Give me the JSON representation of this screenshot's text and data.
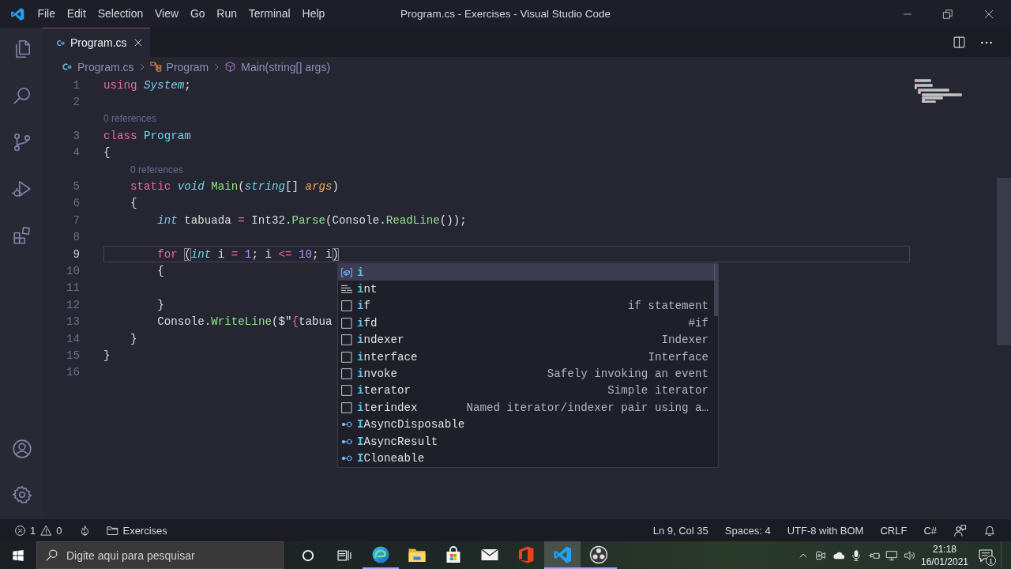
{
  "window": {
    "title": "Program.cs - Exercises - Visual Studio Code"
  },
  "menu": [
    "File",
    "Edit",
    "Selection",
    "View",
    "Go",
    "Run",
    "Terminal",
    "Help"
  ],
  "tabs": [
    {
      "label": "Program.cs",
      "selected": true
    }
  ],
  "breadcrumbs": [
    "Program.cs",
    "Program",
    "Main(string[] args)"
  ],
  "editor": {
    "lines": [
      {
        "kind": "code",
        "number": "1",
        "current": false,
        "tokens": [
          {
            "kind": "keyword",
            "text": "using "
          },
          {
            "kind": "type",
            "text": "System"
          },
          {
            "kind": "plain",
            "text": ";"
          }
        ]
      },
      {
        "kind": "code",
        "number": "2",
        "current": false
      },
      {
        "kind": "codelens",
        "text": "0 references"
      },
      {
        "kind": "code",
        "number": "3",
        "current": false,
        "tokens": [
          {
            "kind": "keyword",
            "text": "class "
          },
          {
            "kind": "class",
            "text": "Program"
          }
        ]
      },
      {
        "kind": "code",
        "number": "4",
        "current": false,
        "tokens": [
          {
            "kind": "plain",
            "text": "{"
          }
        ]
      },
      {
        "kind": "codelens",
        "text": "    0 references"
      },
      {
        "kind": "code",
        "number": "5",
        "current": false,
        "tokens": [
          {
            "kind": "keyword",
            "text": "    static "
          },
          {
            "kind": "type",
            "text": "void "
          },
          {
            "kind": "method",
            "text": "Main"
          },
          {
            "kind": "plain",
            "text": "("
          },
          {
            "kind": "type",
            "text": "string"
          },
          {
            "kind": "plain",
            "text": "[] "
          },
          {
            "kind": "param",
            "text": "args"
          },
          {
            "kind": "plain",
            "text": ")"
          }
        ]
      },
      {
        "kind": "code",
        "number": "6",
        "current": false,
        "tokens": [
          {
            "kind": "plain",
            "text": "    {"
          }
        ]
      },
      {
        "kind": "code",
        "number": "7",
        "current": false,
        "tokens": [
          {
            "kind": "type",
            "text": "        int"
          },
          {
            "kind": "plain",
            "text": " tabuada "
          },
          {
            "kind": "operator",
            "text": "="
          },
          {
            "kind": "plain",
            "text": " Int32."
          },
          {
            "kind": "method",
            "text": "Parse"
          },
          {
            "kind": "plain",
            "text": "(Console."
          },
          {
            "kind": "method",
            "text": "ReadLine"
          },
          {
            "kind": "plain",
            "text": "());"
          }
        ]
      },
      {
        "kind": "code",
        "number": "8",
        "current": false
      },
      {
        "kind": "code",
        "number": "9",
        "current": true,
        "tokens": [
          {
            "kind": "keyword",
            "text": "        for "
          },
          {
            "kind": "bracket",
            "text": "("
          },
          {
            "kind": "type",
            "text": "int"
          },
          {
            "kind": "plain",
            "text": " i "
          },
          {
            "kind": "operator",
            "text": "= "
          },
          {
            "kind": "number",
            "text": "1"
          },
          {
            "kind": "plain",
            "text": "; i "
          },
          {
            "kind": "operator",
            "text": "<= "
          },
          {
            "kind": "number",
            "text": "10"
          },
          {
            "kind": "plain",
            "text": "; i"
          },
          {
            "kind": "bracket",
            "text": ")"
          }
        ]
      },
      {
        "kind": "code",
        "number": "10",
        "current": false,
        "tokens": [
          {
            "kind": "plain",
            "text": "        {"
          }
        ]
      },
      {
        "kind": "code",
        "number": "11",
        "current": false
      },
      {
        "kind": "code",
        "number": "12",
        "current": false,
        "tokens": [
          {
            "kind": "plain",
            "text": "        }"
          }
        ]
      },
      {
        "kind": "code",
        "number": "13",
        "current": false,
        "tokens": [
          {
            "kind": "plain",
            "text": "        Console."
          },
          {
            "kind": "method",
            "text": "WriteLine"
          },
          {
            "kind": "plain",
            "text": "($\""
          },
          {
            "kind": "operator",
            "text": "{"
          },
          {
            "kind": "plain",
            "text": "tabua"
          }
        ]
      },
      {
        "kind": "code",
        "number": "14",
        "current": false,
        "tokens": [
          {
            "kind": "plain",
            "text": "    }"
          }
        ]
      },
      {
        "kind": "code",
        "number": "15",
        "current": false,
        "tokens": [
          {
            "kind": "plain",
            "text": "}"
          }
        ]
      },
      {
        "kind": "code",
        "number": "16",
        "current": false
      }
    ]
  },
  "suggestions": [
    {
      "kind": "variable",
      "label": "i",
      "full_match": true,
      "selected": true
    },
    {
      "kind": "keyword",
      "label": "**i**nt",
      "full_match": false,
      "selected": false
    },
    {
      "kind": "snippet",
      "label": "**i**f",
      "detail": "if statement",
      "full_match": false,
      "selected": false
    },
    {
      "kind": "snippet",
      "label": "**i**fd",
      "detail": "#if",
      "full_match": false,
      "selected": false
    },
    {
      "kind": "snippet",
      "label": "**i**ndexer",
      "detail": "Indexer",
      "full_match": false,
      "selected": false
    },
    {
      "kind": "snippet",
      "label": "**i**nterface",
      "detail": "Interface",
      "full_match": false,
      "selected": false
    },
    {
      "kind": "snippet",
      "label": "**i**nvoke",
      "detail": "Safely invoking an event",
      "full_match": false,
      "selected": false
    },
    {
      "kind": "snippet",
      "label": "**i**terator",
      "detail": "Simple iterator",
      "full_match": false,
      "selected": false
    },
    {
      "kind": "snippet",
      "label": "**i**terindex",
      "detail": "Named iterator/indexer pair using a…",
      "full_match": false,
      "selected": false
    },
    {
      "kind": "interface",
      "label": "**I**AsyncDisposable",
      "full_match": false,
      "selected": false
    },
    {
      "kind": "interface",
      "label": "**I**AsyncResult",
      "full_match": false,
      "selected": false
    },
    {
      "kind": "interface",
      "label": "**I**Cloneable",
      "full_match": false,
      "selected": false
    }
  ],
  "status_bar": {
    "errors": "1",
    "warnings": "0",
    "folder": "Exercises",
    "items": [
      "Ln 9, Col 35",
      "Spaces: 4",
      "UTF-8 with BOM",
      "CRLF",
      "C#"
    ]
  },
  "taskbar": {
    "search": {
      "placeholder": "Digite aqui para pesquisar"
    },
    "apps": [
      {
        "running": true,
        "selected": false
      },
      {
        "running": false,
        "selected": false
      },
      {
        "running": false,
        "selected": false
      },
      {
        "running": false,
        "selected": false
      },
      {
        "running": false,
        "selected": false
      },
      {
        "running": true,
        "selected": true
      },
      {
        "running": true,
        "selected": false
      }
    ],
    "time": "21:18",
    "date": "16/01/2021",
    "notifications": "1"
  }
}
